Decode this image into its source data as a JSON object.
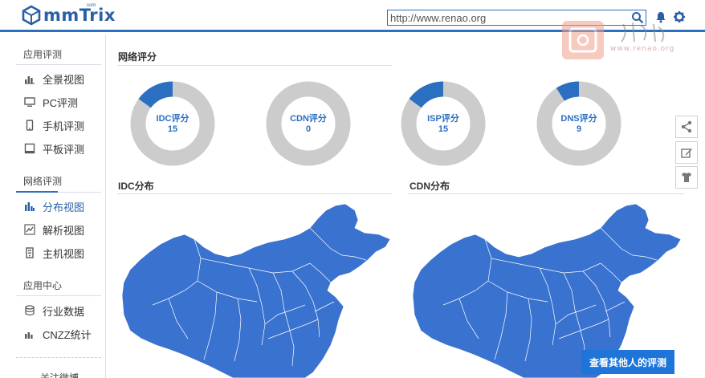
{
  "header": {
    "logo_text": "mmTrix",
    "logo_sub": "com",
    "search_value": "http://www.renao.org",
    "icons": [
      "search-icon",
      "bell-icon",
      "gear-icon"
    ]
  },
  "watermark": {
    "text": "www.renao.org"
  },
  "sidebar": {
    "sections": [
      {
        "title": "应用评测",
        "items": [
          {
            "label": "全景视图",
            "icon": "bar-chart-icon"
          },
          {
            "label": "PC评测",
            "icon": "monitor-icon"
          },
          {
            "label": "手机评测",
            "icon": "phone-icon"
          },
          {
            "label": "平板评测",
            "icon": "tablet-icon"
          }
        ]
      },
      {
        "title": "网络评测",
        "items": [
          {
            "label": "分布视图",
            "icon": "distribution-icon",
            "active": true
          },
          {
            "label": "解析视图",
            "icon": "line-chart-icon"
          },
          {
            "label": "主机视图",
            "icon": "server-icon"
          }
        ]
      },
      {
        "title": "应用中心",
        "items": [
          {
            "label": "行业数据",
            "icon": "database-icon"
          },
          {
            "label": "CNZZ统计",
            "icon": "stats-icon"
          }
        ]
      }
    ],
    "footer": "关注微博"
  },
  "main": {
    "network_score_title": "网络评分",
    "idc_distribution_title": "IDC分布",
    "cdn_distribution_title": "CDN分布"
  },
  "chart_data": {
    "type": "pie",
    "series": [
      {
        "name": "IDC评分",
        "value": 15,
        "fraction": 0.15
      },
      {
        "name": "CDN评分",
        "value": 0,
        "fraction": 0
      },
      {
        "name": "ISP评分",
        "value": 15,
        "fraction": 0.15
      },
      {
        "name": "DNS评分",
        "value": 9,
        "fraction": 0.09
      }
    ],
    "colors": {
      "fill": "#2a6fc0",
      "track": "#cccccc"
    }
  },
  "float_bar": {
    "icons": [
      "share-icon",
      "edit-icon",
      "tshirt-icon"
    ]
  },
  "cta": {
    "label": "查看其他人的评测"
  },
  "colors": {
    "accent": "#2a6fc0",
    "map_fill": "#3a72cf",
    "cta": "#1e74d9"
  }
}
